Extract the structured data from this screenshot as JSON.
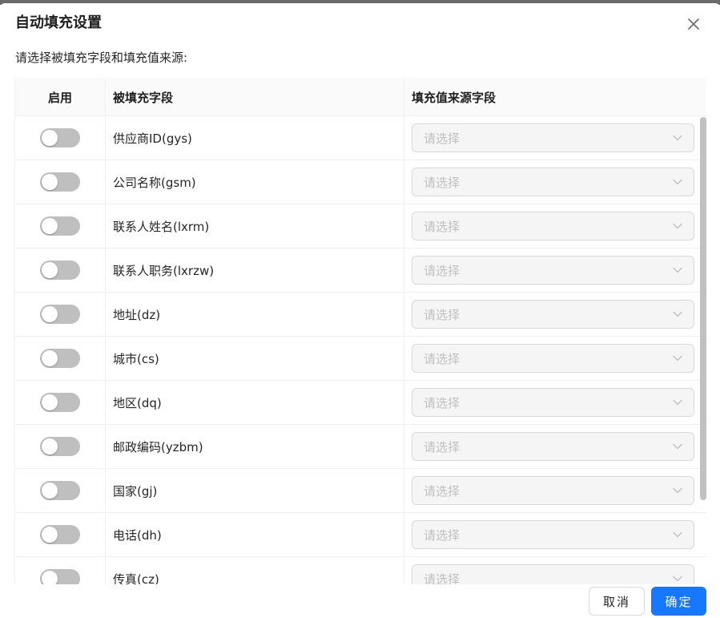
{
  "dialog": {
    "title": "自动填充设置",
    "subtitle": "请选择被填充字段和填充值来源:"
  },
  "table": {
    "headers": {
      "enable": "启用",
      "target_field": "被填充字段",
      "source_field": "填充值来源字段"
    },
    "rows": [
      {
        "field": "供应商ID(gys)",
        "enabled": false,
        "source_placeholder": "请选择"
      },
      {
        "field": "公司名称(gsm)",
        "enabled": false,
        "source_placeholder": "请选择"
      },
      {
        "field": "联系人姓名(lxrm)",
        "enabled": false,
        "source_placeholder": "请选择"
      },
      {
        "field": "联系人职务(lxrzw)",
        "enabled": false,
        "source_placeholder": "请选择"
      },
      {
        "field": "地址(dz)",
        "enabled": false,
        "source_placeholder": "请选择"
      },
      {
        "field": "城市(cs)",
        "enabled": false,
        "source_placeholder": "请选择"
      },
      {
        "field": "地区(dq)",
        "enabled": false,
        "source_placeholder": "请选择"
      },
      {
        "field": "邮政编码(yzbm)",
        "enabled": false,
        "source_placeholder": "请选择"
      },
      {
        "field": "国家(gj)",
        "enabled": false,
        "source_placeholder": "请选择"
      },
      {
        "field": "电话(dh)",
        "enabled": false,
        "source_placeholder": "请选择"
      },
      {
        "field": "传真(cz)",
        "enabled": false,
        "source_placeholder": "请选择"
      }
    ]
  },
  "footer": {
    "cancel_label": "取消",
    "ok_label": "确定"
  },
  "icons": {
    "close": "close-icon",
    "dropdown": "chevron-down-icon"
  },
  "colors": {
    "primary": "#1677ff",
    "switch_off": "#bfbfbf",
    "placeholder": "#bfbfbf"
  }
}
